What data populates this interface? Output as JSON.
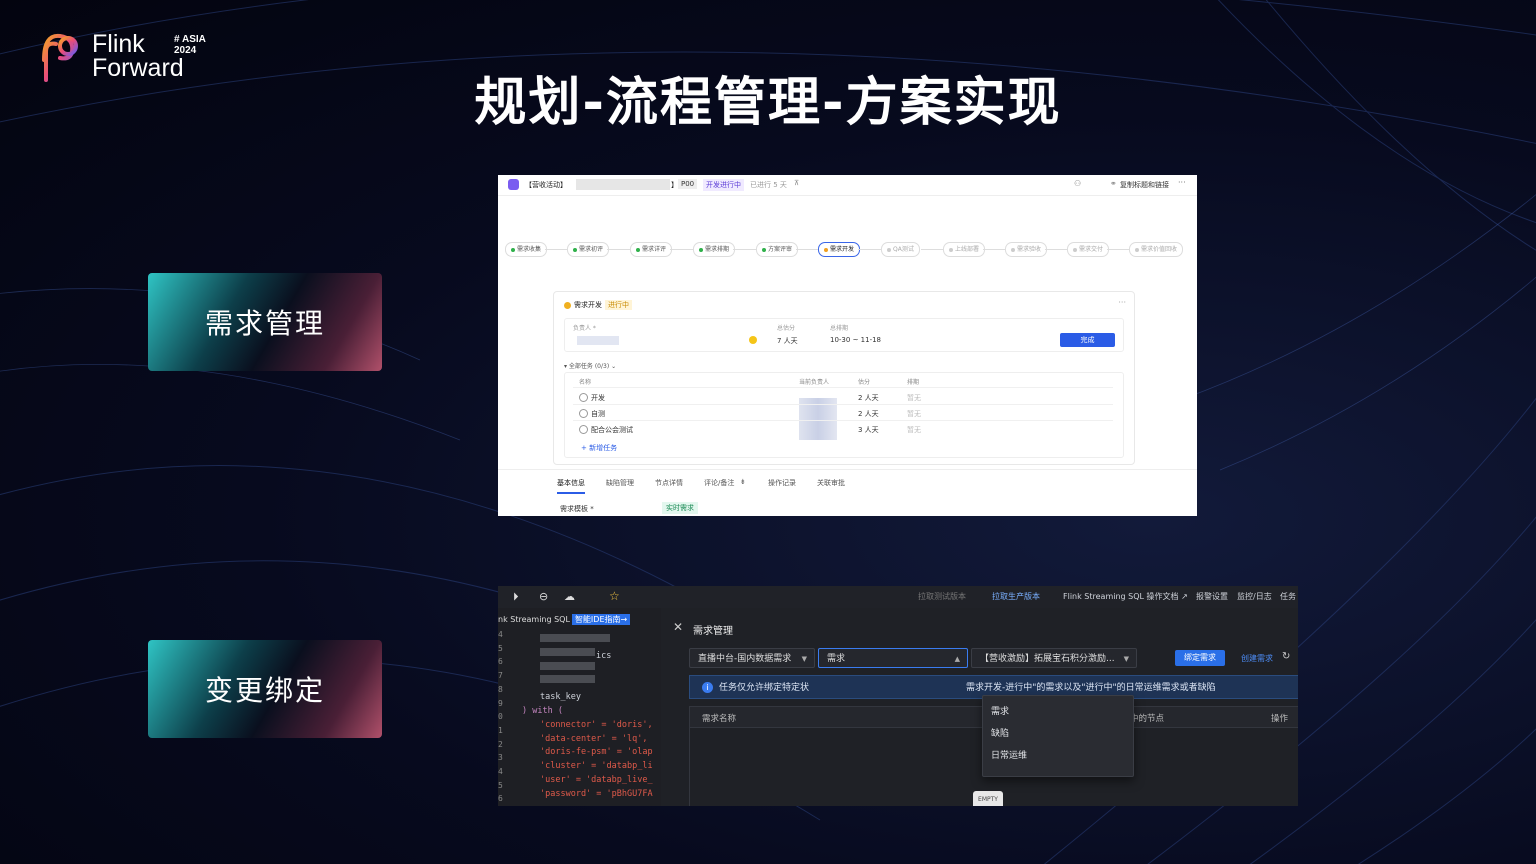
{
  "brand": {
    "line1": "Flink",
    "line2": "Forward",
    "event_hash": "#",
    "event_region": "ASIA",
    "event_year": "2024"
  },
  "slide_title": "规划-流程管理-方案实现",
  "cards": [
    {
      "label": "需求管理"
    },
    {
      "label": "变更绑定"
    }
  ],
  "shot1": {
    "header": {
      "activity_tag": "【营收活动】",
      "bracket_close": "】",
      "priority": "P00",
      "status": "开发进行中",
      "elapsed": "已进行 5 天",
      "pin": "⊼",
      "copy_title_link": "复制标题和链接",
      "more": "···"
    },
    "steps": [
      {
        "label": "需求收集",
        "state": "done"
      },
      {
        "label": "需求初评",
        "state": "done"
      },
      {
        "label": "需求详评",
        "state": "done"
      },
      {
        "label": "需求排期",
        "state": "done"
      },
      {
        "label": "方案评审",
        "state": "done"
      },
      {
        "label": "需求开发",
        "state": "current"
      },
      {
        "label": "QA测试",
        "state": "todo"
      },
      {
        "label": "上线部署",
        "state": "todo"
      },
      {
        "label": "需求验收",
        "state": "todo"
      },
      {
        "label": "需求交付",
        "state": "todo"
      },
      {
        "label": "需求价值回收",
        "state": "todo"
      }
    ],
    "panel": {
      "title": "需求开发",
      "status_tag": "进行中",
      "more": "···",
      "owner_label": "负责人 *",
      "estimate_label": "总估分",
      "estimate_value": "7 人天",
      "schedule_label": "总排期",
      "schedule_value": "10-30 ~ 11-18",
      "done_button": "完成",
      "subtasks_label": "全部任务 (0/3)",
      "columns": [
        "名称",
        "当前负责人",
        "估分",
        "排期"
      ],
      "tasks": [
        {
          "name": "开发",
          "estimate": "2 人天",
          "schedule": "暂无"
        },
        {
          "name": "自测",
          "estimate": "2 人天",
          "schedule": "暂无"
        },
        {
          "name": "配合公会测试",
          "estimate": "3 人天",
          "schedule": "暂无"
        }
      ],
      "add_task": "+ 新增任务"
    },
    "tabs": [
      "基本信息",
      "缺陷管理",
      "节点详情",
      "评论/备注",
      "操作记录",
      "关联审批"
    ],
    "template_label": "需求模板 *",
    "template_value": "实时需求"
  },
  "shot2": {
    "toolbar": {
      "pull_test": "拉取测试版本",
      "pull_prod": "拉取生产版本",
      "doc": "Flink Streaming SQL 操作文档 ↗",
      "alert_settings": "报警设置",
      "monitor_logs": "监控/日志",
      "tasks": "任务"
    },
    "editor": {
      "title": "nk Streaming SQL",
      "ide_guide": "智能IDE指南→",
      "line_numbers": [
        "4",
        "5",
        "6",
        "7",
        "8",
        "9",
        "0",
        "1",
        "2",
        "3",
        "4",
        "5",
        "6"
      ],
      "code_lines": [
        {
          "text": "ics",
          "kind": "w"
        },
        {
          "text": "task_key",
          "kind": "w"
        },
        {
          "text": ") with (",
          "kind": "k"
        },
        {
          "text": "'connector' = 'doris',",
          "kind": "s"
        },
        {
          "text": "'data-center' = 'lq',",
          "kind": "s"
        },
        {
          "text": "'doris-fe-psm' = 'olap",
          "kind": "s"
        },
        {
          "text": "'cluster' = 'databp_li",
          "kind": "s"
        },
        {
          "text": "'user' = 'databp_live_",
          "kind": "s"
        },
        {
          "text": "'password' = 'pBhGU7FA",
          "kind": "s"
        }
      ]
    },
    "drawer": {
      "title": "需求管理",
      "select_dept": "直播中台-国内数据需求",
      "select_type": "需求",
      "select_item": "【营收激励】拓展宝石积分激励...",
      "bind_button": "绑定需求",
      "create_link": "创建需求",
      "notice_left": "任务仅允许绑定特定状",
      "notice_right": "需求开发-进行中\"的需求以及\"进行中\"的日常运维需求或者缺陷",
      "columns": [
        "需求名称",
        "分类",
        "进行中的节点",
        "操作"
      ],
      "dropdown_options": [
        "需求",
        "缺陷",
        "日常运维"
      ],
      "empty_text": "EMPTY"
    }
  }
}
